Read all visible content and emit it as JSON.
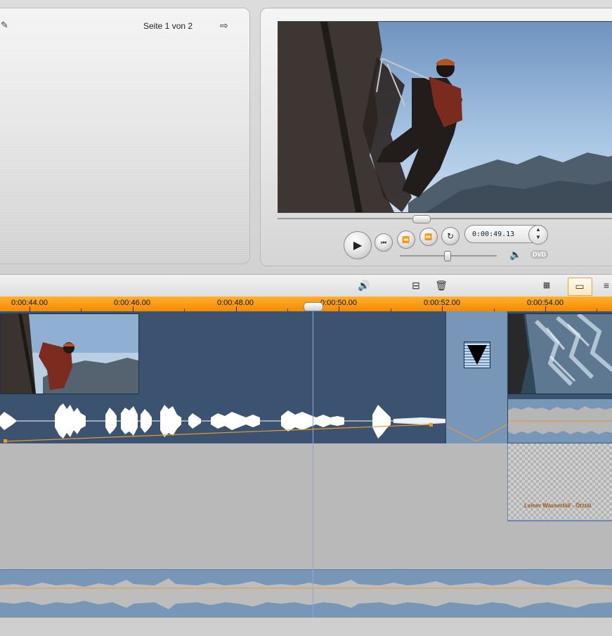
{
  "album_panel": {
    "page_label": "Seite 1 von 2",
    "next_icon": "arrow-right-icon",
    "edit_icon": "wand-icon"
  },
  "player": {
    "timecode": "0:00:49.13",
    "dvd_label": "DVD",
    "volume_level_percent": 46,
    "play_icon": "play-icon",
    "controls": [
      "go-to-start-icon",
      "rewind-icon",
      "fast-forward-icon",
      "loop-icon"
    ]
  },
  "toolbar": {
    "icons": [
      "audio-scrub-icon",
      "razor-split-icon",
      "trash-icon",
      "storyboard-view-icon",
      "timeline-view-icon",
      "text-view-icon"
    ]
  },
  "ruler": {
    "labels": [
      "0:00:44.00",
      "0:00:46.00",
      "0:00:48.00",
      "0:00:50.00",
      "0:00:52.00",
      "0:00:54.00"
    ]
  },
  "timeline": {
    "title_clip_text": "Leiner Wasserfall - Ötztal",
    "playhead_time": "0:00:49.13"
  },
  "colors": {
    "ruler_orange": "#f48a00",
    "track_blue": "#3b5370",
    "transition_blue": "#7896b8",
    "volume_line": "#e89a2c"
  }
}
